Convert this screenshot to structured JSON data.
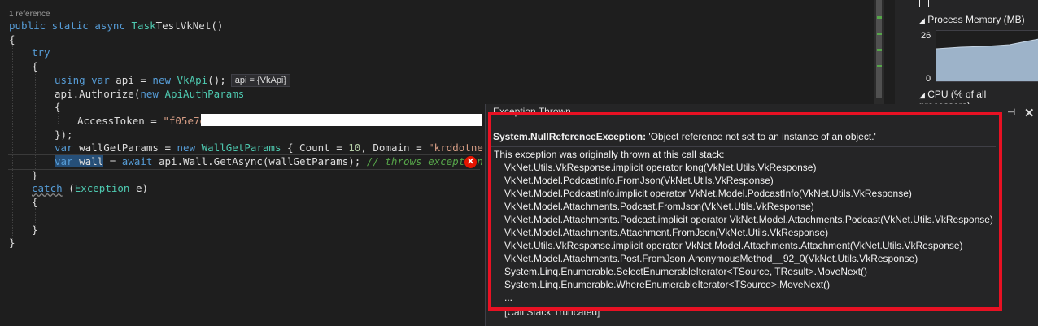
{
  "editor": {
    "codelens": "1 reference",
    "lines": [
      {
        "id": "sig",
        "parts": [
          [
            "kw",
            "public static async "
          ],
          [
            "ty",
            "Task"
          ],
          [
            "",
            "TestVkNet()"
          ]
        ]
      },
      {
        "id": "brace-open",
        "parts": [
          [
            "",
            "{"
          ]
        ]
      },
      {
        "id": "try",
        "parts": [
          [
            "kw",
            "try"
          ]
        ]
      },
      {
        "id": "try-open",
        "parts": [
          [
            "",
            "{"
          ]
        ]
      },
      {
        "id": "using",
        "parts": [
          [
            "kw",
            "using var "
          ],
          [
            "",
            "api = "
          ],
          [
            "kw",
            "new "
          ],
          [
            "ty",
            "VkApi"
          ],
          [
            "",
            "();"
          ]
        ]
      },
      {
        "id": "authorize",
        "parts": [
          [
            "",
            "api.Authorize("
          ],
          [
            "kw",
            "new "
          ],
          [
            "ty",
            "ApiAuthParams"
          ]
        ]
      },
      {
        "id": "init-open",
        "parts": [
          [
            "",
            "{"
          ]
        ]
      },
      {
        "id": "token",
        "parts": [
          [
            "",
            "AccessToken = "
          ],
          [
            "str",
            "\"f05e7e"
          ]
        ]
      },
      {
        "id": "init-close",
        "parts": [
          [
            "",
            "});"
          ]
        ]
      },
      {
        "id": "wallparams",
        "parts": [
          [
            "kw",
            "var "
          ],
          [
            "",
            "wallGetParams = "
          ],
          [
            "kw",
            "new "
          ],
          [
            "ty",
            "WallGetParams"
          ],
          [
            "",
            " { Count = "
          ],
          [
            "num",
            "10"
          ],
          [
            "",
            ", Domain = "
          ],
          [
            "str",
            "\"krddotnet\""
          ],
          [
            "",
            " };"
          ]
        ]
      },
      {
        "id": "wallcall",
        "parts": [
          [
            "kw sel",
            "var"
          ],
          [
            "sel",
            " "
          ],
          [
            "sel",
            "wall"
          ],
          [
            "",
            " = "
          ],
          [
            "kw",
            "await "
          ],
          [
            "",
            "api.Wall.GetAsync(wallGetParams); "
          ],
          [
            "cm",
            "// throws exception"
          ]
        ]
      },
      {
        "id": "try-close",
        "parts": [
          [
            "",
            "}"
          ]
        ]
      },
      {
        "id": "catch",
        "parts": [
          [
            "kw warn-squiggle",
            "catch"
          ],
          [
            "",
            " ("
          ],
          [
            "ty",
            "Exception "
          ],
          [
            "",
            "e)"
          ]
        ]
      },
      {
        "id": "catch-open",
        "parts": [
          [
            "",
            "{"
          ]
        ]
      },
      {
        "id": "blank",
        "parts": [
          [
            "",
            ""
          ]
        ]
      },
      {
        "id": "catch-close",
        "parts": [
          [
            "",
            "}"
          ]
        ]
      },
      {
        "id": "brace-close",
        "parts": [
          [
            "",
            "}"
          ]
        ]
      }
    ],
    "datatip": "api = {VkApi}"
  },
  "diagnostics": {
    "process_memory_label": "Process Memory (MB)",
    "mem_max": "26",
    "mem_min": "0",
    "cpu_label": "CPU (% of all processors)"
  },
  "exception": {
    "title": "Exception Thrown",
    "pin": "⊣",
    "close": "✕",
    "type": "System.NullReferenceException:",
    "message": " 'Object reference not set to an instance of an object.'",
    "stack_header": "This exception was originally thrown at this call stack:",
    "frames": [
      "VkNet.Utils.VkResponse.implicit operator long(VkNet.Utils.VkResponse)",
      "VkNet.Model.PodcastInfo.FromJson(VkNet.Utils.VkResponse)",
      "VkNet.Model.PodcastInfo.implicit operator VkNet.Model.PodcastInfo(VkNet.Utils.VkResponse)",
      "VkNet.Model.Attachments.Podcast.FromJson(VkNet.Utils.VkResponse)",
      "VkNet.Model.Attachments.Podcast.implicit operator VkNet.Model.Attachments.Podcast(VkNet.Utils.VkResponse)",
      "VkNet.Model.Attachments.Attachment.FromJson(VkNet.Utils.VkResponse)",
      "VkNet.Utils.VkResponse.implicit operator VkNet.Model.Attachments.Attachment(VkNet.Utils.VkResponse)",
      "VkNet.Model.Attachments.Post.FromJson.AnonymousMethod__92_0(VkNet.Utils.VkResponse)",
      "System.Linq.Enumerable.SelectEnumerableIterator<TSource, TResult>.MoveNext()",
      "System.Linq.Enumerable.WhereEnumerableIterator<TSource>.MoveNext()",
      "..."
    ],
    "truncated": "[Call Stack Truncated]"
  },
  "colors": {
    "highlight_border": "#e81123",
    "editor_bg": "#1e1e1e"
  }
}
